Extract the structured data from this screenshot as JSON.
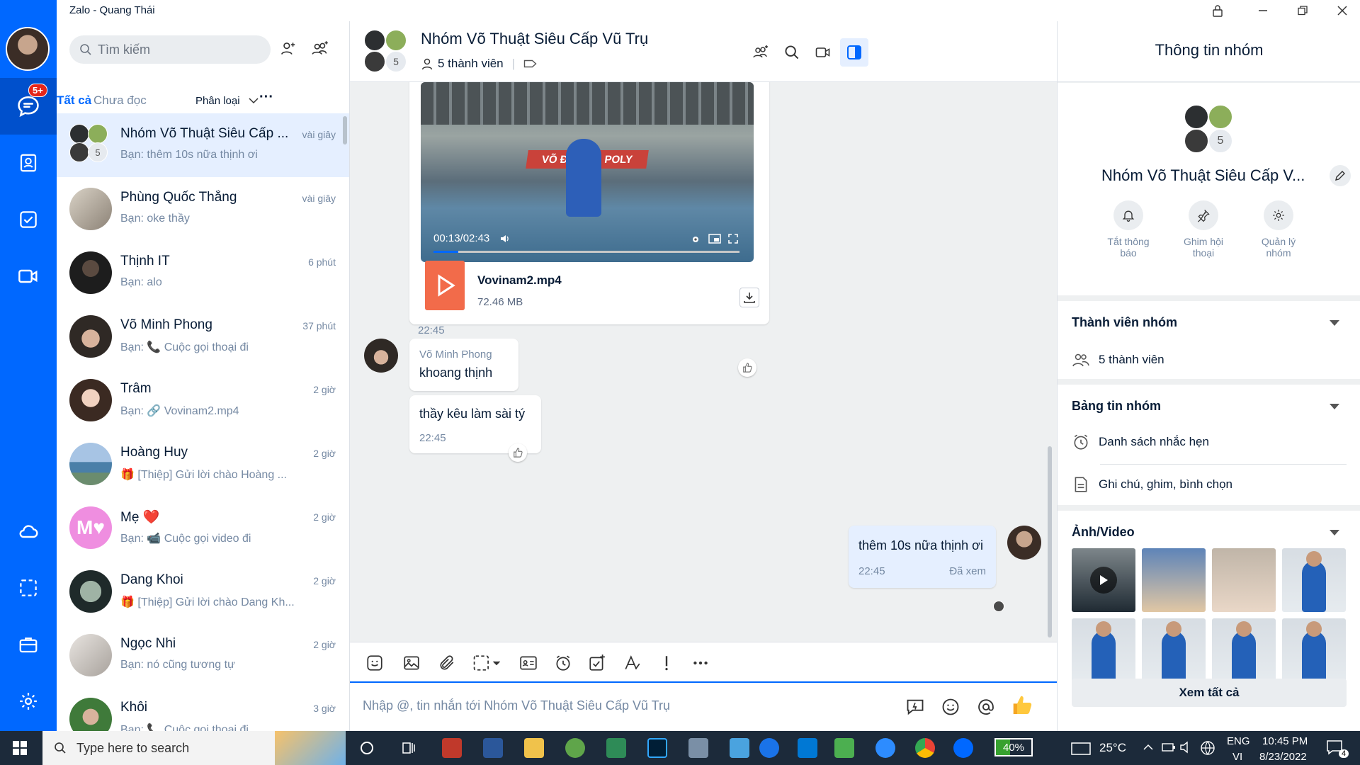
{
  "window": {
    "title": "Zalo - Quang Thái"
  },
  "rail": {
    "badge": "5+"
  },
  "search": {
    "placeholder": "Tìm kiếm"
  },
  "tabs": {
    "all": "Tất cả",
    "unread": "Chưa đọc",
    "classify": "Phân loại",
    "more": "···"
  },
  "conversations": [
    {
      "name": "Nhóm Võ Thuật Siêu Cấp ...",
      "last": "Bạn: thêm 10s nữa thịnh ơi",
      "time": "vài giây",
      "member_count": "5",
      "selected": true
    },
    {
      "name": "Phùng Quốc Thắng",
      "last": "Bạn: oke thầy",
      "time": "vài giây"
    },
    {
      "name": "Thịnh IT",
      "last": "Bạn: alo",
      "time": "6 phút"
    },
    {
      "name": "Võ Minh Phong",
      "last": "Bạn: 📞 Cuộc gọi thoại đi",
      "time": "37 phút"
    },
    {
      "name": "Trâm",
      "last": "Bạn: 🔗 Vovinam2.mp4",
      "time": "2 giờ"
    },
    {
      "name": "Hoàng Huy",
      "last": "🎁 [Thiệp] Gửi lời chào Hoàng ...",
      "time": "2 giờ"
    },
    {
      "name": "Mẹ ❤️",
      "last": "Bạn: 📹 Cuộc gọi video đi",
      "time": "2 giờ"
    },
    {
      "name": "Dang Khoi",
      "last": "🎁 [Thiệp] Gửi lời chào Dang Kh...",
      "time": "2 giờ"
    },
    {
      "name": "Ngọc Nhi",
      "last": "Bạn: nó cũng tương tự",
      "time": "2 giờ"
    },
    {
      "name": "Khôi",
      "last": "Bạn: 📞 Cuộc gọi thoại đi",
      "time": "3 giờ"
    }
  ],
  "chat": {
    "title": "Nhóm Võ Thuật Siêu Cấp Vũ Trụ",
    "members": "5 thành viên",
    "avatar_count": "5",
    "video": {
      "time": "00:13/02:43",
      "progress": 0.08,
      "sign": "VÕ ĐƯỜNG POLY"
    },
    "file": {
      "name": "Vovinam2.mp4",
      "size": "72.46 MB",
      "time": "22:45"
    },
    "messages": [
      {
        "sender": "Võ Minh Phong",
        "text": "khoang thịnh"
      },
      {
        "text": "thầy kêu làm sài tý",
        "time": "22:45"
      },
      {
        "text": "thêm 10s nữa thịnh ơi",
        "time": "22:45",
        "status": "Đã xem",
        "mine": true
      }
    ],
    "composer_placeholder": "Nhập @, tin nhắn tới Nhóm Võ Thuật Siêu Cấp Vũ Trụ"
  },
  "info": {
    "header": "Thông tin nhóm",
    "group_name": "Nhóm Võ Thuật Siêu Cấp V...",
    "avatar_count": "5",
    "actions": [
      {
        "line1": "Tắt thông",
        "line2": "báo"
      },
      {
        "line1": "Ghim hội",
        "line2": "thoại"
      },
      {
        "line1": "Quản lý",
        "line2": "nhóm"
      }
    ],
    "members_title": "Thành viên nhóm",
    "members_count": "5 thành viên",
    "board_title": "Bảng tin nhóm",
    "reminders": "Danh sách nhắc hẹn",
    "notes": "Ghi chú, ghim, bình chọn",
    "media_title": "Ảnh/Video",
    "see_all": "Xem tất cả"
  },
  "taskbar": {
    "search": "Type here to search",
    "battery": "40%",
    "temp": "25°C",
    "lang1": "ENG",
    "lang2": "VI",
    "time": "10:45 PM",
    "date": "8/23/2022",
    "notif": "4"
  },
  "colors": {
    "accent": "#0068ff",
    "rail": "#0068ff",
    "taskbar": "#1c2a3a"
  }
}
